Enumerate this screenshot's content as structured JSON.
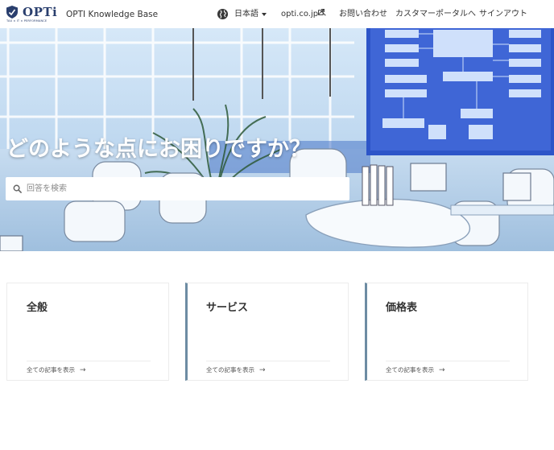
{
  "header": {
    "logo_text": "OPTi",
    "logo_tagline": "TAX × IT × PERFORMANCE",
    "site_title": "OPTI Knowledge Base",
    "language": "日本語",
    "external_link": "opti.co.jpへ",
    "contact": "お問い合わせ",
    "customer_portal": "カスタマーポータルへ",
    "sign_in": "サインアウト"
  },
  "hero": {
    "title": "どのような点にお困りですか？",
    "search_placeholder": "回答を検索"
  },
  "categories": [
    {
      "title": "全般",
      "link": "全ての記事を表示"
    },
    {
      "title": "サービス",
      "link": "全ての記事を表示"
    },
    {
      "title": "価格表",
      "link": "全ての記事を表示"
    }
  ],
  "icons": {
    "logo": "shield-logo-icon",
    "language": "globe-icon",
    "language_caret": "caret-down-icon",
    "external": "external-link-icon",
    "search": "search-icon",
    "card_link": "arrow-right-icon"
  },
  "colors": {
    "brand": "#2a3f6e",
    "card_accent": "#6d8ca3",
    "hero_sky": "#dcebf8",
    "hero_floor": "#b9d2ea",
    "hero_screen": "#2d55c8"
  }
}
